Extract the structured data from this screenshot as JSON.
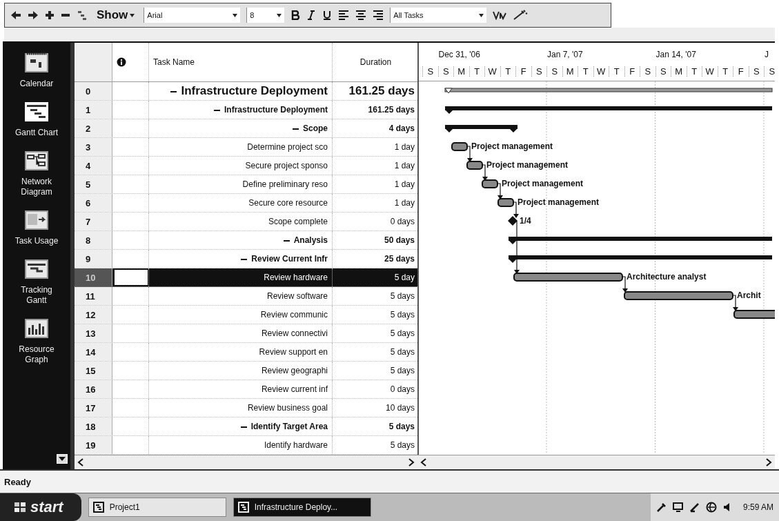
{
  "toolbar": {
    "show_label": "Show",
    "font": "Arial",
    "font_size": "8",
    "filter": "All Tasks"
  },
  "view_bar": {
    "items": [
      {
        "label": "Calendar",
        "kind": "calendar",
        "selected": false
      },
      {
        "label": "Gantt Chart",
        "kind": "gantt",
        "selected": true
      },
      {
        "label": "Network Diagram",
        "kind": "network",
        "selected": false
      },
      {
        "label": "Task Usage",
        "kind": "usage",
        "selected": false
      },
      {
        "label": "Tracking Gantt",
        "kind": "tracking",
        "selected": false
      },
      {
        "label": "Resource Graph",
        "kind": "graph",
        "selected": false
      }
    ]
  },
  "table": {
    "columns": [
      "Task Name",
      "Duration"
    ],
    "rows": [
      {
        "id": "0",
        "name": "Infrastructure Deployment",
        "duration": "161.25 days",
        "kind": "project",
        "expanded": true,
        "selected": false,
        "children": [
          {
            "id": "1",
            "name": "Infrastructure Deployment",
            "duration": "161.25 days",
            "kind": "summary",
            "expanded": true,
            "selected": false,
            "children": [
              {
                "id": "2",
                "name": "Scope",
                "duration": "4 days",
                "kind": "summary",
                "expanded": true,
                "selected": false,
                "children": [
                  {
                    "id": "3",
                    "name": "Determine project sco",
                    "duration": "1 day",
                    "kind": "task",
                    "selected": false,
                    "bar_label": "Project management"
                  },
                  {
                    "id": "4",
                    "name": "Secure project sponso",
                    "duration": "1 day",
                    "kind": "task",
                    "selected": false,
                    "bar_label": "Project management"
                  },
                  {
                    "id": "5",
                    "name": "Define preliminary reso",
                    "duration": "1 day",
                    "kind": "task",
                    "selected": false,
                    "bar_label": "Project management"
                  },
                  {
                    "id": "6",
                    "name": "Secure core resource",
                    "duration": "1 day",
                    "kind": "task",
                    "selected": false,
                    "bar_label": "Project management"
                  },
                  {
                    "id": "7",
                    "name": "Scope complete",
                    "duration": "0 days",
                    "kind": "milestone",
                    "selected": false,
                    "bar_label": "1/4"
                  }
                ]
              },
              {
                "id": "8",
                "name": "Analysis",
                "duration": "50 days",
                "kind": "summary",
                "expanded": true,
                "selected": false,
                "children": [
                  {
                    "id": "9",
                    "name": "Review Current Infr",
                    "duration": "25 days",
                    "kind": "summary",
                    "expanded": true,
                    "selected": false,
                    "children": [
                      {
                        "id": "10",
                        "name": "Review hardware",
                        "duration": "5 day",
                        "kind": "task",
                        "selected": true,
                        "bar_label": "Architecture analyst"
                      },
                      {
                        "id": "11",
                        "name": "Review software",
                        "duration": "5 days",
                        "kind": "task",
                        "selected": false,
                        "bar_label": "Archit"
                      },
                      {
                        "id": "12",
                        "name": "Review communic",
                        "duration": "5 days",
                        "kind": "task",
                        "selected": false
                      },
                      {
                        "id": "13",
                        "name": "Review connectivi",
                        "duration": "5 days",
                        "kind": "task",
                        "selected": false
                      },
                      {
                        "id": "14",
                        "name": "Review support en",
                        "duration": "5 days",
                        "kind": "task",
                        "selected": false
                      },
                      {
                        "id": "15",
                        "name": "Review geographi",
                        "duration": "5 days",
                        "kind": "task",
                        "selected": false
                      },
                      {
                        "id": "16",
                        "name": "Review current inf",
                        "duration": "0 days",
                        "kind": "task",
                        "selected": false
                      }
                    ]
                  },
                  {
                    "id": "17",
                    "name": "Review business goal",
                    "duration": "10 days",
                    "kind": "task",
                    "selected": false
                  },
                  {
                    "id": "18",
                    "name": "Identify Target Area",
                    "duration": "5 days",
                    "kind": "summary",
                    "expanded": true,
                    "selected": false,
                    "children": [
                      {
                        "id": "19",
                        "name": "Identify hardware",
                        "duration": "5 days",
                        "kind": "task",
                        "selected": false
                      }
                    ]
                  }
                ]
              }
            ]
          }
        ]
      }
    ]
  },
  "gantt": {
    "weeks": [
      "Dec 31, '06",
      "Jan 7, '07",
      "Jan 14, '07",
      "J"
    ],
    "days": [
      "S",
      "S",
      "M",
      "T",
      "W",
      "T",
      "F",
      "S",
      "S",
      "M",
      "T",
      "W",
      "T",
      "F",
      "S",
      "S",
      "M",
      "T",
      "W",
      "T",
      "F",
      "S",
      "S"
    ]
  },
  "status_bar": "Ready",
  "taskbar": {
    "start": "start",
    "buttons": [
      {
        "label": "Project1",
        "selected": false
      },
      {
        "label": "Infrastructure Deploy...",
        "selected": true
      }
    ],
    "clock": "9:59 AM"
  }
}
